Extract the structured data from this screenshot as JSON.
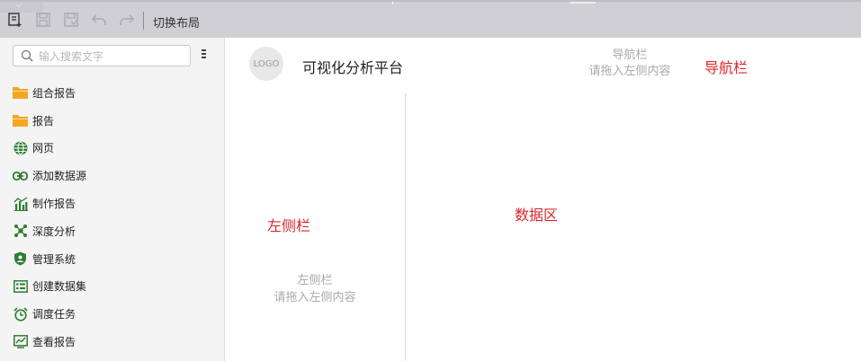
{
  "toolbar": {
    "buttons": [
      {
        "name": "new-report-icon"
      },
      {
        "name": "save-icon"
      },
      {
        "name": "save-as-icon"
      },
      {
        "name": "undo-icon"
      },
      {
        "name": "redo-icon"
      }
    ],
    "switch_layout_label": "切换布局"
  },
  "sidebar": {
    "search": {
      "placeholder": "输入搜索文字",
      "value": ""
    },
    "items": [
      {
        "label": "组合报告",
        "icon": "folder-icon",
        "color": "#f5a623"
      },
      {
        "label": "报告",
        "icon": "folder-icon",
        "color": "#f5a623"
      },
      {
        "label": "网页",
        "icon": "globe-icon",
        "color": "#2e7d32"
      },
      {
        "label": "添加数据源",
        "icon": "link-icon",
        "color": "#2e7d32"
      },
      {
        "label": "制作报告",
        "icon": "bar-chart-icon",
        "color": "#2e7d32"
      },
      {
        "label": "深度分析",
        "icon": "network-icon",
        "color": "#2e7d32"
      },
      {
        "label": "管理系统",
        "icon": "shield-user-icon",
        "color": "#2e7d32"
      },
      {
        "label": "创建数据集",
        "icon": "dataset-icon",
        "color": "#2e7d32"
      },
      {
        "label": "调度任务",
        "icon": "alarm-clock-icon",
        "color": "#2e7d32"
      },
      {
        "label": "查看报告",
        "icon": "line-chart-icon",
        "color": "#2e7d32"
      }
    ]
  },
  "header": {
    "logo_text": "LOGO",
    "app_title": "可视化分析平台",
    "nav_hint_line1": "导航栏",
    "nav_hint_line2": "请拖入左侧内容",
    "nav_label": "导航栏"
  },
  "left_pane": {
    "label": "左侧栏",
    "hint_line1": "左侧栏",
    "hint_line2": "请拖入左侧内容"
  },
  "data_area": {
    "label": "数据区"
  },
  "colors": {
    "accent_red": "#d9262c",
    "icon_green": "#2e7d32",
    "folder_orange": "#f5a623"
  }
}
